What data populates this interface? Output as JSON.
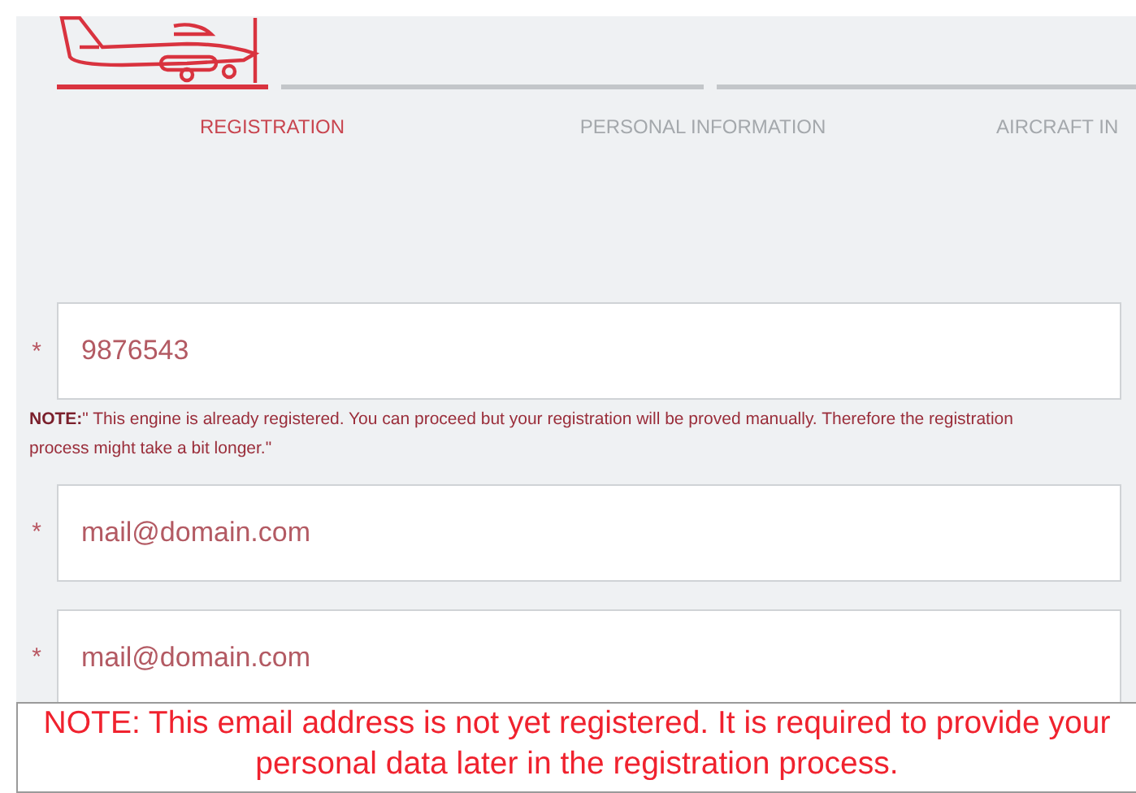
{
  "steps": [
    {
      "label": "REGISTRATION",
      "selected": true
    },
    {
      "label": "PERSONAL INFORMATION",
      "selected": false
    },
    {
      "label": "AIRCRAFT IN",
      "selected": false
    }
  ],
  "fields": [
    {
      "required": true,
      "marker": "*",
      "value": "9876543",
      "note": "**NOTE:**\" This engine is already registered. You can proceed but your registration will be proved manually. Therefore the registration process might take a bit longer.\""
    },
    {
      "required": true,
      "marker": "*",
      "value": "mail@domain.com"
    },
    {
      "required": true,
      "marker": "*",
      "value": "mail@domain.com"
    }
  ],
  "bottom_note": "NOTE: This email address is not yet registered. It is required to provide your personal data later in the registration process."
}
